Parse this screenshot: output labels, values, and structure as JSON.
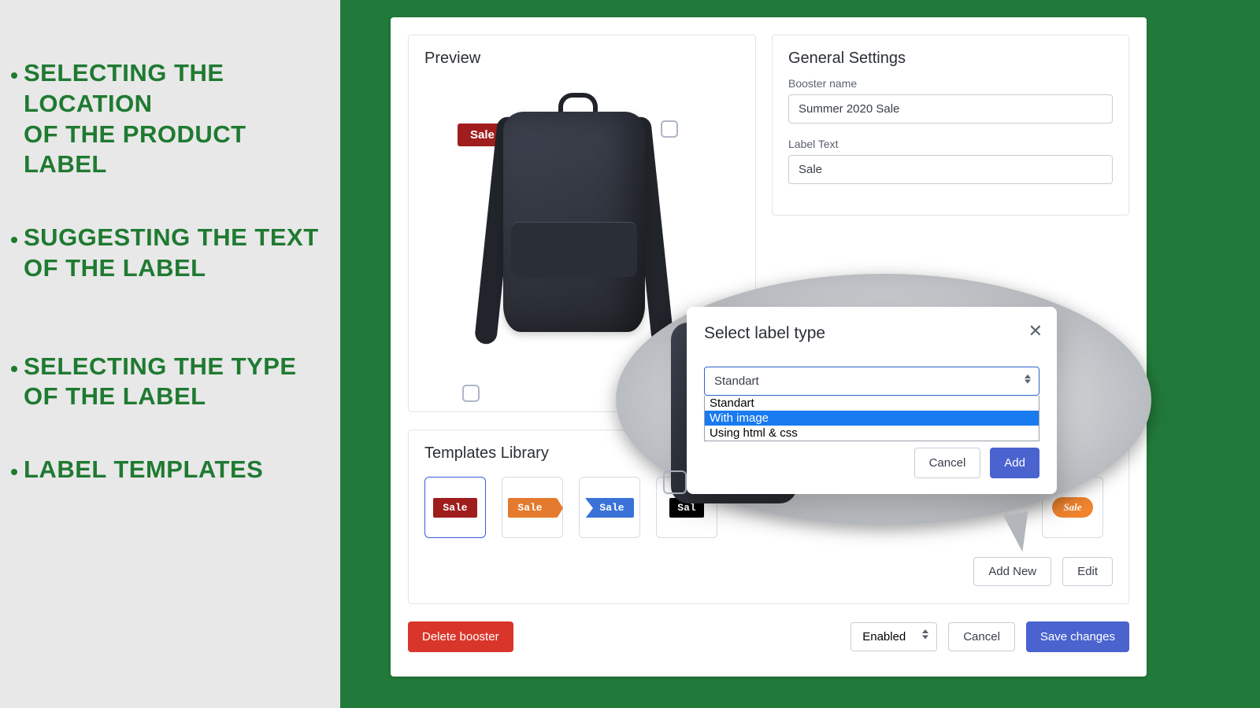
{
  "rail": {
    "b1a": "SELECTING THE LOCATION",
    "b1b": "OF THE PRODUCT LABEL",
    "b2a": "SUGGESTING THE TEXT",
    "b2b": "OF THE LABEL",
    "b3a": "SELECTING THE TYPE",
    "b3b": "OF THE LABEL",
    "b4": "LABEL TEMPLATES"
  },
  "preview": {
    "title": "Preview",
    "tag": "Sale"
  },
  "settings": {
    "title": "General Settings",
    "name_label": "Booster name",
    "name_value": "Summer 2020 Sale",
    "text_label": "Label Text",
    "text_value": "Sale"
  },
  "templates": {
    "title": "Templates Library",
    "items": [
      "Sale",
      "Sale",
      "Sale",
      "Sal",
      "Sale"
    ],
    "add_new": "Add New",
    "edit": "Edit"
  },
  "footer": {
    "delete": "Delete booster",
    "status": "Enabled",
    "cancel": "Cancel",
    "save": "Save changes"
  },
  "modal": {
    "title": "Select label type",
    "selected": "Standart",
    "options": [
      "Standart",
      "With image",
      "Using html & css"
    ],
    "cancel": "Cancel",
    "add": "Add"
  }
}
